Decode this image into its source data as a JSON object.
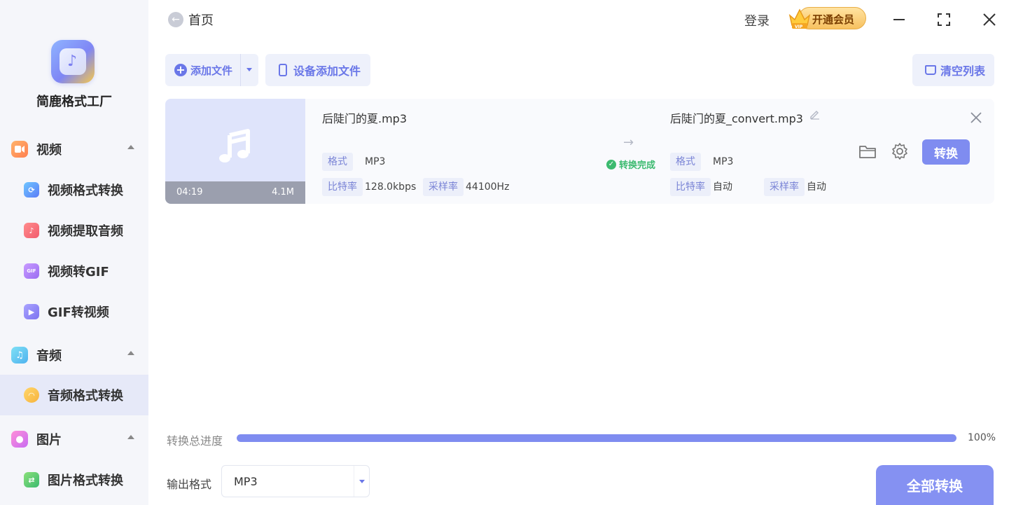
{
  "sidebar": {
    "app_name": "简鹿格式工厂",
    "sections": {
      "video": {
        "label": "视频",
        "color": "#ff9a5c"
      },
      "audio": {
        "label": "音频",
        "color": "#5ec3f2"
      },
      "image": {
        "label": "图片",
        "color": "#f06cc4"
      }
    },
    "items": {
      "video_convert": "视频格式转换",
      "video_extract_audio": "视频提取音频",
      "video_to_gif": "视频转GIF",
      "gif_to_video": "GIF转视频",
      "audio_convert": "音频格式转换",
      "image_convert": "图片格式转换"
    },
    "icon_text": {
      "gif": "GIF"
    }
  },
  "header": {
    "back_label": "首页",
    "login_label": "登录",
    "vip_label": "开通会员",
    "vip_badge": "VIP"
  },
  "toolbar": {
    "add_file": "添加文件",
    "device_add": "设备添加文件",
    "clear_list": "清空列表"
  },
  "file": {
    "duration": "04:19",
    "size": "4.1M",
    "source_name": "后陡门的夏.mp3",
    "target_name": "后陡门的夏_convert.mp3",
    "status": "转换完成",
    "convert_label": "转换",
    "labels": {
      "format": "格式",
      "bitrate": "比特率",
      "sample_rate": "采样率"
    },
    "source": {
      "format": "MP3",
      "bitrate": "128.0kbps",
      "sample_rate": "44100Hz"
    },
    "target": {
      "format": "MP3",
      "bitrate": "自动",
      "sample_rate": "自动"
    }
  },
  "footer": {
    "progress_label": "转换总进度",
    "progress_percent": 100,
    "progress_text": "100%",
    "output_format_label": "输出格式",
    "output_format_value": "MP3",
    "convert_all": "全部转换"
  },
  "colors": {
    "accent": "#7f8cf0",
    "success": "#3cba6f",
    "sidebar_bg": "#f5f6fa",
    "active_item_bg": "#e6e9f8"
  }
}
